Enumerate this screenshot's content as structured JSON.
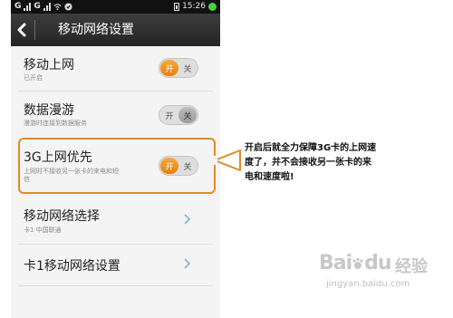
{
  "statusbar": {
    "carrier1": "G",
    "carrier2": "G",
    "time": "15:26",
    "dot_color": "#4bd13b"
  },
  "titlebar": {
    "back_icon": "chevron-left-icon",
    "title": "移动网络设置"
  },
  "settings": [
    {
      "title": "移动上网",
      "subtitle": "已开启",
      "toggle": {
        "on_label": "开",
        "off_label": "关",
        "state": "on"
      }
    },
    {
      "title": "数据漫游",
      "subtitle": "漫游时连接到数据服务",
      "toggle": {
        "on_label": "开",
        "off_label": "关",
        "state": "off"
      }
    },
    {
      "title": "3G上网优先",
      "subtitle_line1": "上网时不接收另一张卡的来电和短",
      "subtitle_line2": "信",
      "toggle": {
        "on_label": "开",
        "off_label": "关",
        "state": "on"
      }
    },
    {
      "title": "移动网络选择",
      "subtitle": "卡1 中国联通",
      "icon": "chevron-right-icon"
    },
    {
      "title": "卡1移动网络设置",
      "icon": "chevron-right-icon"
    }
  ],
  "annotation": {
    "line1": "开启后就全力保障3G卡的上网速",
    "line2": "度了，并不会接收另一张卡的来",
    "line3": "电和速度啦!"
  },
  "watermark": {
    "logo": "Bai",
    "paw": "du",
    "cn": "经验",
    "url": "jingyan.baidu.com"
  },
  "colors": {
    "accent_orange": "#e97f08",
    "callout_border": "#e08b2a",
    "titlebar": "#2e2e2e"
  }
}
